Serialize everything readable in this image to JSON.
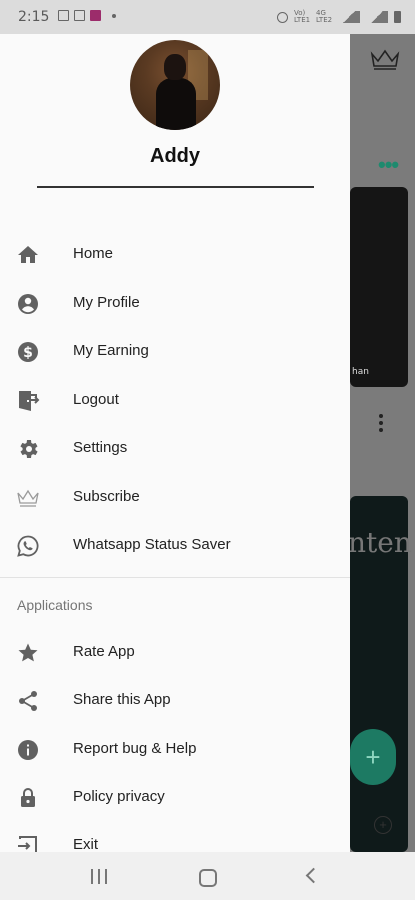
{
  "status_bar": {
    "time": "2:15",
    "net_label_1": "Vo) LTE1",
    "net_label_2": "4G LTE2"
  },
  "drawer": {
    "user_name": "Addy",
    "menu": [
      {
        "label": "Home",
        "icon": "home-icon"
      },
      {
        "label": "My Profile",
        "icon": "account-circle-icon"
      },
      {
        "label": "My Earning",
        "icon": "dollar-circle-icon"
      },
      {
        "label": "Logout",
        "icon": "logout-door-icon"
      },
      {
        "label": "Settings",
        "icon": "gear-icon"
      },
      {
        "label": "Subscribe",
        "icon": "crown-icon"
      },
      {
        "label": "Whatsapp Status Saver",
        "icon": "whatsapp-icon"
      }
    ],
    "section_label": "Applications",
    "apps": [
      {
        "label": "Rate App",
        "icon": "star-icon"
      },
      {
        "label": "Share this App",
        "icon": "share-icon"
      },
      {
        "label": "Report bug & Help",
        "icon": "info-icon"
      },
      {
        "label": "Policy privacy",
        "icon": "lock-icon"
      },
      {
        "label": "Exit",
        "icon": "exit-icon"
      }
    ]
  },
  "background": {
    "card_caption": "han",
    "card_text": "nten",
    "fab_label": "+"
  },
  "colors": {
    "accent_green": "#1e8a6e",
    "drawer_bg": "#fafafa",
    "icon_gray": "#616161"
  }
}
